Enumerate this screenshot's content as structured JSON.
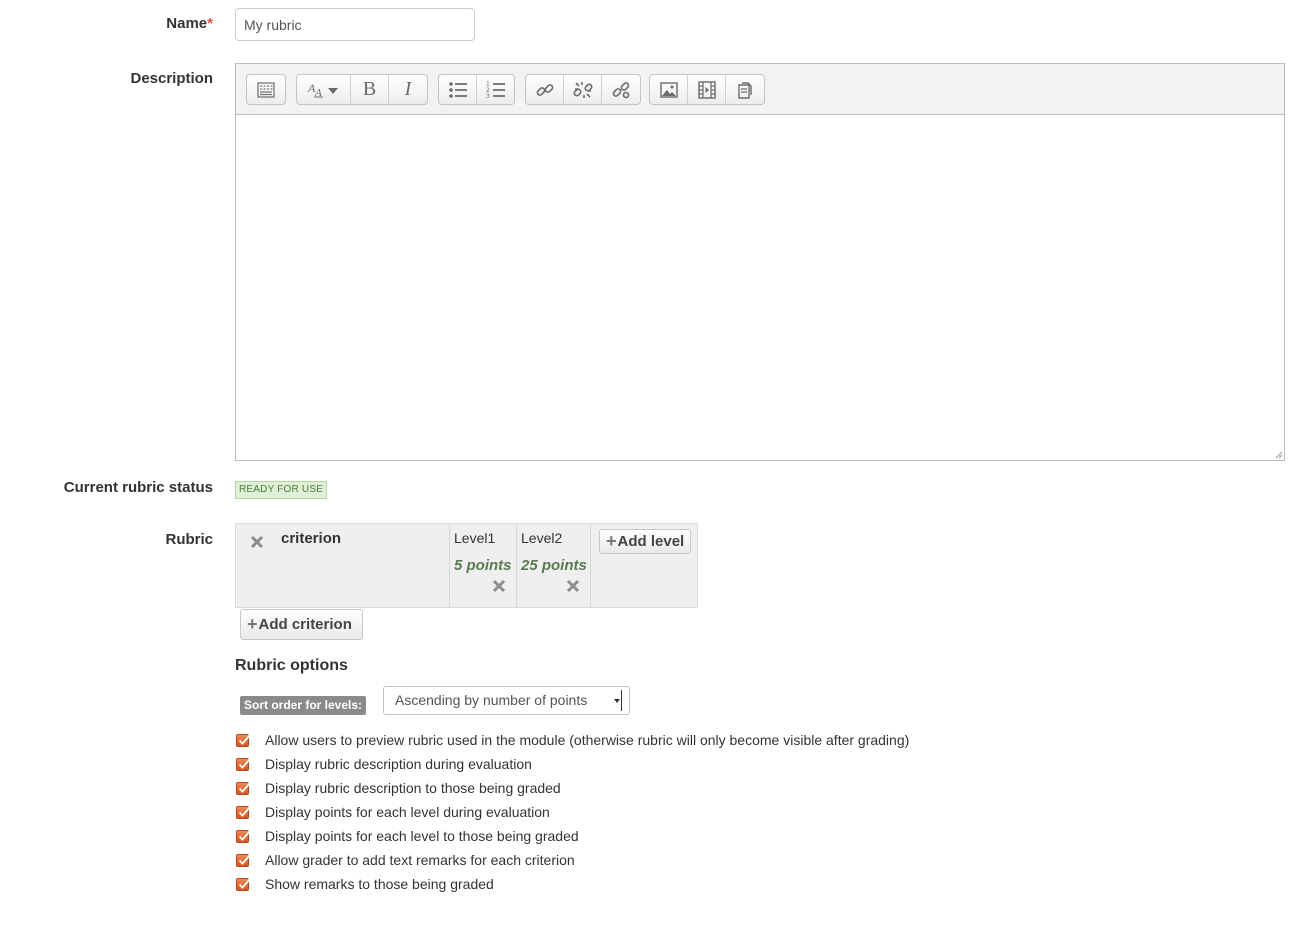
{
  "form": {
    "name_label": "Name",
    "required_marker": "*",
    "name_value": "My rubric",
    "description_label": "Description",
    "status_label": "Current rubric status",
    "status_value": "READY FOR USE",
    "rubric_label": "Rubric"
  },
  "editor": {
    "toolbar_groups": [
      [
        "toggle-toolbar-icon"
      ],
      [
        "font-style-icon",
        "bold-icon",
        "italic-icon"
      ],
      [
        "unordered-list-icon",
        "ordered-list-icon"
      ],
      [
        "link-icon",
        "unlink-icon",
        "manage-links-icon"
      ],
      [
        "image-icon",
        "media-icon",
        "manage-files-icon"
      ]
    ],
    "bold_glyph": "B",
    "italic_glyph": "I",
    "content": ""
  },
  "rubric": {
    "criterion": "criterion",
    "levels": [
      {
        "definition": "Level1",
        "points": "5 points"
      },
      {
        "definition": "Level2",
        "points": "25 points"
      }
    ],
    "add_level_label": "Add level",
    "add_criterion_label": "Add criterion",
    "plus_glyph": "+"
  },
  "options": {
    "title": "Rubric options",
    "sort_label": "Sort order for levels:",
    "sort_selected": "Ascending by number of points",
    "checkboxes": [
      {
        "label": "Allow users to preview rubric used in the module (otherwise rubric will only become visible after grading)",
        "checked": true
      },
      {
        "label": "Display rubric description during evaluation",
        "checked": true
      },
      {
        "label": "Display rubric description to those being graded",
        "checked": true
      },
      {
        "label": "Display points for each level during evaluation",
        "checked": true
      },
      {
        "label": "Display points for each level to those being graded",
        "checked": true
      },
      {
        "label": "Allow grader to add text remarks for each criterion",
        "checked": true
      },
      {
        "label": "Show remarks to those being graded",
        "checked": true
      }
    ]
  },
  "colors": {
    "checkbox": "#e2632b",
    "status_bg": "#dff0d8",
    "points_text": "#5a7a52",
    "required": "#d9534f"
  }
}
